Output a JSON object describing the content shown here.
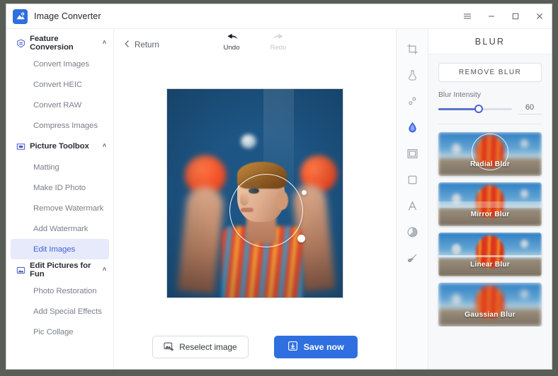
{
  "window": {
    "app_title": "Image Converter",
    "logo_icon": "photo-mountain-icon",
    "controls": [
      {
        "name": "menu-button",
        "icon": "hamburger-icon",
        "glyph": "☰"
      },
      {
        "name": "minimize-button",
        "icon": "minimize-icon",
        "glyph": "−"
      },
      {
        "name": "maximize-button",
        "icon": "maximize-icon",
        "glyph": "□"
      },
      {
        "name": "close-button",
        "icon": "close-icon",
        "glyph": "✕"
      }
    ]
  },
  "sidebar": {
    "groups": [
      {
        "label": "Feature Conversion",
        "icon": "convert-badge-icon",
        "expanded_chevron": "˄",
        "items": [
          {
            "label": "Convert Images",
            "active": false
          },
          {
            "label": "Convert HEIC",
            "active": false
          },
          {
            "label": "Convert RAW",
            "active": false
          },
          {
            "label": "Compress Images",
            "active": false
          }
        ]
      },
      {
        "label": "Picture Toolbox",
        "icon": "toolbox-frame-icon",
        "expanded_chevron": "˄",
        "items": [
          {
            "label": "Matting",
            "active": false
          },
          {
            "label": "Make ID Photo",
            "active": false
          },
          {
            "label": "Remove Watermark",
            "active": false
          },
          {
            "label": "Add Watermark",
            "active": false
          },
          {
            "label": "Edit Images",
            "active": true
          }
        ]
      },
      {
        "label": "Edit Pictures for Fun",
        "icon": "fun-picture-icon",
        "expanded_chevron": "˄",
        "items": [
          {
            "label": "Photo Restoration",
            "active": false
          },
          {
            "label": "Add Special Effects",
            "active": false
          },
          {
            "label": "Pic Collage",
            "active": false
          }
        ]
      }
    ]
  },
  "editor": {
    "return_label": "Return",
    "return_icon": "chevron-left-icon",
    "history": [
      {
        "label": "Undo",
        "icon": "undo-arrow-icon",
        "enabled": true
      },
      {
        "label": "Redo",
        "icon": "redo-arrow-icon",
        "enabled": false
      }
    ],
    "canvas": {
      "name": "image-canvas",
      "selection_shape": "circle",
      "handles": [
        "top-handle",
        "bottom-right-handle"
      ]
    },
    "actions": {
      "reselect_label": "Reselect image",
      "reselect_icon": "image-swap-icon",
      "save_label": "Save now",
      "save_icon": "download-box-icon"
    }
  },
  "tool_strip": {
    "tools": [
      {
        "name": "crop-tool",
        "icon": "crop-icon",
        "active": false
      },
      {
        "name": "filter-tool",
        "icon": "flask-icon",
        "active": false
      },
      {
        "name": "adjust-tool",
        "icon": "dots-adjust-icon",
        "active": false
      },
      {
        "name": "blur-tool",
        "icon": "water-drop-icon",
        "active": true
      },
      {
        "name": "frame-tool",
        "icon": "frame-icon",
        "active": false
      },
      {
        "name": "border-tool",
        "icon": "square-icon",
        "active": false
      },
      {
        "name": "text-tool",
        "icon": "text-a-icon",
        "active": false
      },
      {
        "name": "sticker-tool",
        "icon": "sticker-icon",
        "active": false
      },
      {
        "name": "brush-tool",
        "icon": "brush-icon",
        "active": false
      }
    ]
  },
  "right_panel": {
    "title": "BLUR",
    "remove_label": "REMOVE BLUR",
    "intensity_label": "Blur Intensity",
    "intensity_value": "60",
    "intensity_percent": 55,
    "presets": [
      {
        "label": "Radial Blur",
        "selected": true
      },
      {
        "label": "Mirror Blur",
        "selected": false
      },
      {
        "label": "Linear Blur",
        "selected": false
      },
      {
        "label": "Gaussian Blur",
        "selected": false
      }
    ]
  },
  "colors": {
    "accent": "#2f6fe0",
    "active_nav_bg": "#e6eafb",
    "active_nav_text": "#4463d8",
    "slider_fill": "#5a74c8",
    "panel_bg": "#f7f8fa",
    "desktop_bg": "#585d55"
  }
}
